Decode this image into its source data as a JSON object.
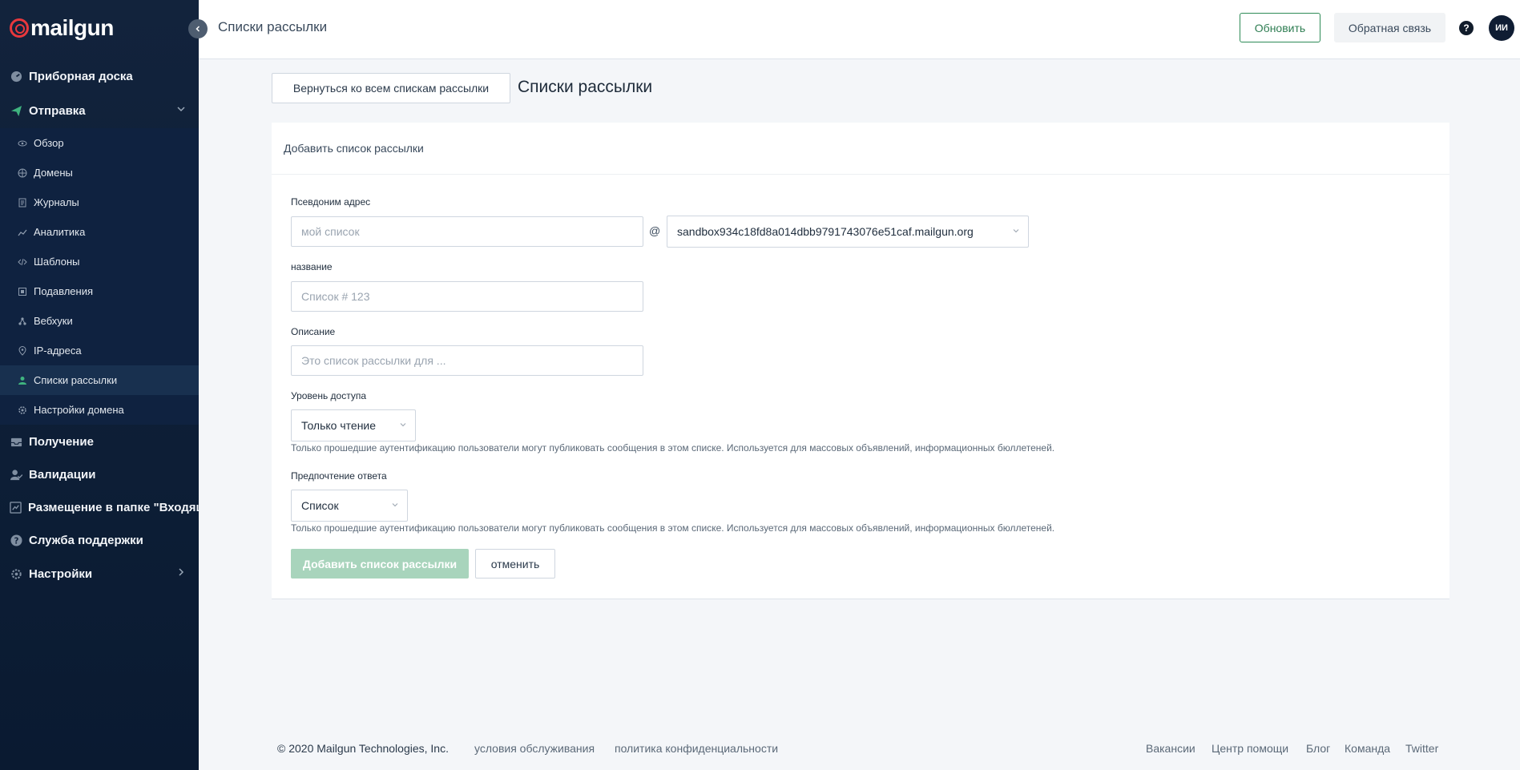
{
  "app": {
    "logo_text": "mailgun"
  },
  "sidebar": {
    "top_items": [
      {
        "label": "Приборная доска",
        "icon": "dashboard-icon"
      },
      {
        "label": "Отправка",
        "icon": "send-icon"
      }
    ],
    "sending_items": [
      {
        "label": "Обзор",
        "icon": "eye-icon"
      },
      {
        "label": "Домены",
        "icon": "globe-icon"
      },
      {
        "label": "Журналы",
        "icon": "logs-icon"
      },
      {
        "label": "Аналитика",
        "icon": "analytics-icon"
      },
      {
        "label": "Шаблоны",
        "icon": "code-icon"
      },
      {
        "label": "Подавления",
        "icon": "suppression-icon"
      },
      {
        "label": "Вебхуки",
        "icon": "webhook-icon"
      },
      {
        "label": "IP-адреса",
        "icon": "location-icon"
      },
      {
        "label": "Списки рассылки",
        "icon": "user-icon",
        "active": true
      },
      {
        "label": "Настройки домена",
        "icon": "gear-icon"
      }
    ],
    "bottom_items": [
      {
        "label": "Получение",
        "icon": "inbox-icon"
      },
      {
        "label": "Валидации",
        "icon": "validation-icon"
      },
      {
        "label": "Размещение в папке \"Входящие\"",
        "icon": "placement-icon"
      },
      {
        "label": "Служба поддержки",
        "icon": "support-icon"
      },
      {
        "label": "Настройки",
        "icon": "settings-icon"
      }
    ]
  },
  "header": {
    "title": "Списки рассылки",
    "refresh_label": "Обновить",
    "feedback_label": "Обратная связь",
    "help_glyph": "?",
    "avatar_initials": "ИИ"
  },
  "main": {
    "back_button": "Вернуться ко всем спискам рассылки",
    "page_title": "Списки рассылки",
    "card_title": "Добавить список рассылки",
    "alias_label": "Псевдоним адрес",
    "alias_placeholder": "мой список",
    "at_sign": "@",
    "domain_value": "sandbox934c18fd8a014dbb9791743076e51caf.mailgun.org",
    "name_label": "название",
    "name_placeholder": "Список # 123",
    "description_label": "Описание",
    "description_placeholder": "Это список рассылки для ...",
    "access_label": "Уровень доступа",
    "access_value": "Только чтение",
    "access_hint": "Только прошедшие аутентификацию пользователи могут публиковать сообщения в этом списке. Используется для массовых объявлений, информационных бюллетеней.",
    "reply_label": "Предпочтение ответа",
    "reply_value": "Список",
    "reply_hint": "Только прошедшие аутентификацию пользователи могут публиковать сообщения в этом списке. Используется для массовых объявлений, информационных бюллетеней.",
    "add_button": "Добавить список рассылки",
    "cancel_button": "отменить"
  },
  "footer": {
    "copyright": "© 2020 Mailgun Technologies, Inc.",
    "terms": "условия обслуживания",
    "privacy": "политика конфиденциальности",
    "links": [
      "Вакансии",
      "Центр помощи",
      "Блог",
      "Команда",
      "Twitter"
    ]
  },
  "colors": {
    "sidebar_bg": "#12233c",
    "accent_green": "#2e8b57",
    "brand_red": "#e8383d",
    "disabled_green": "#a8d4bc"
  }
}
